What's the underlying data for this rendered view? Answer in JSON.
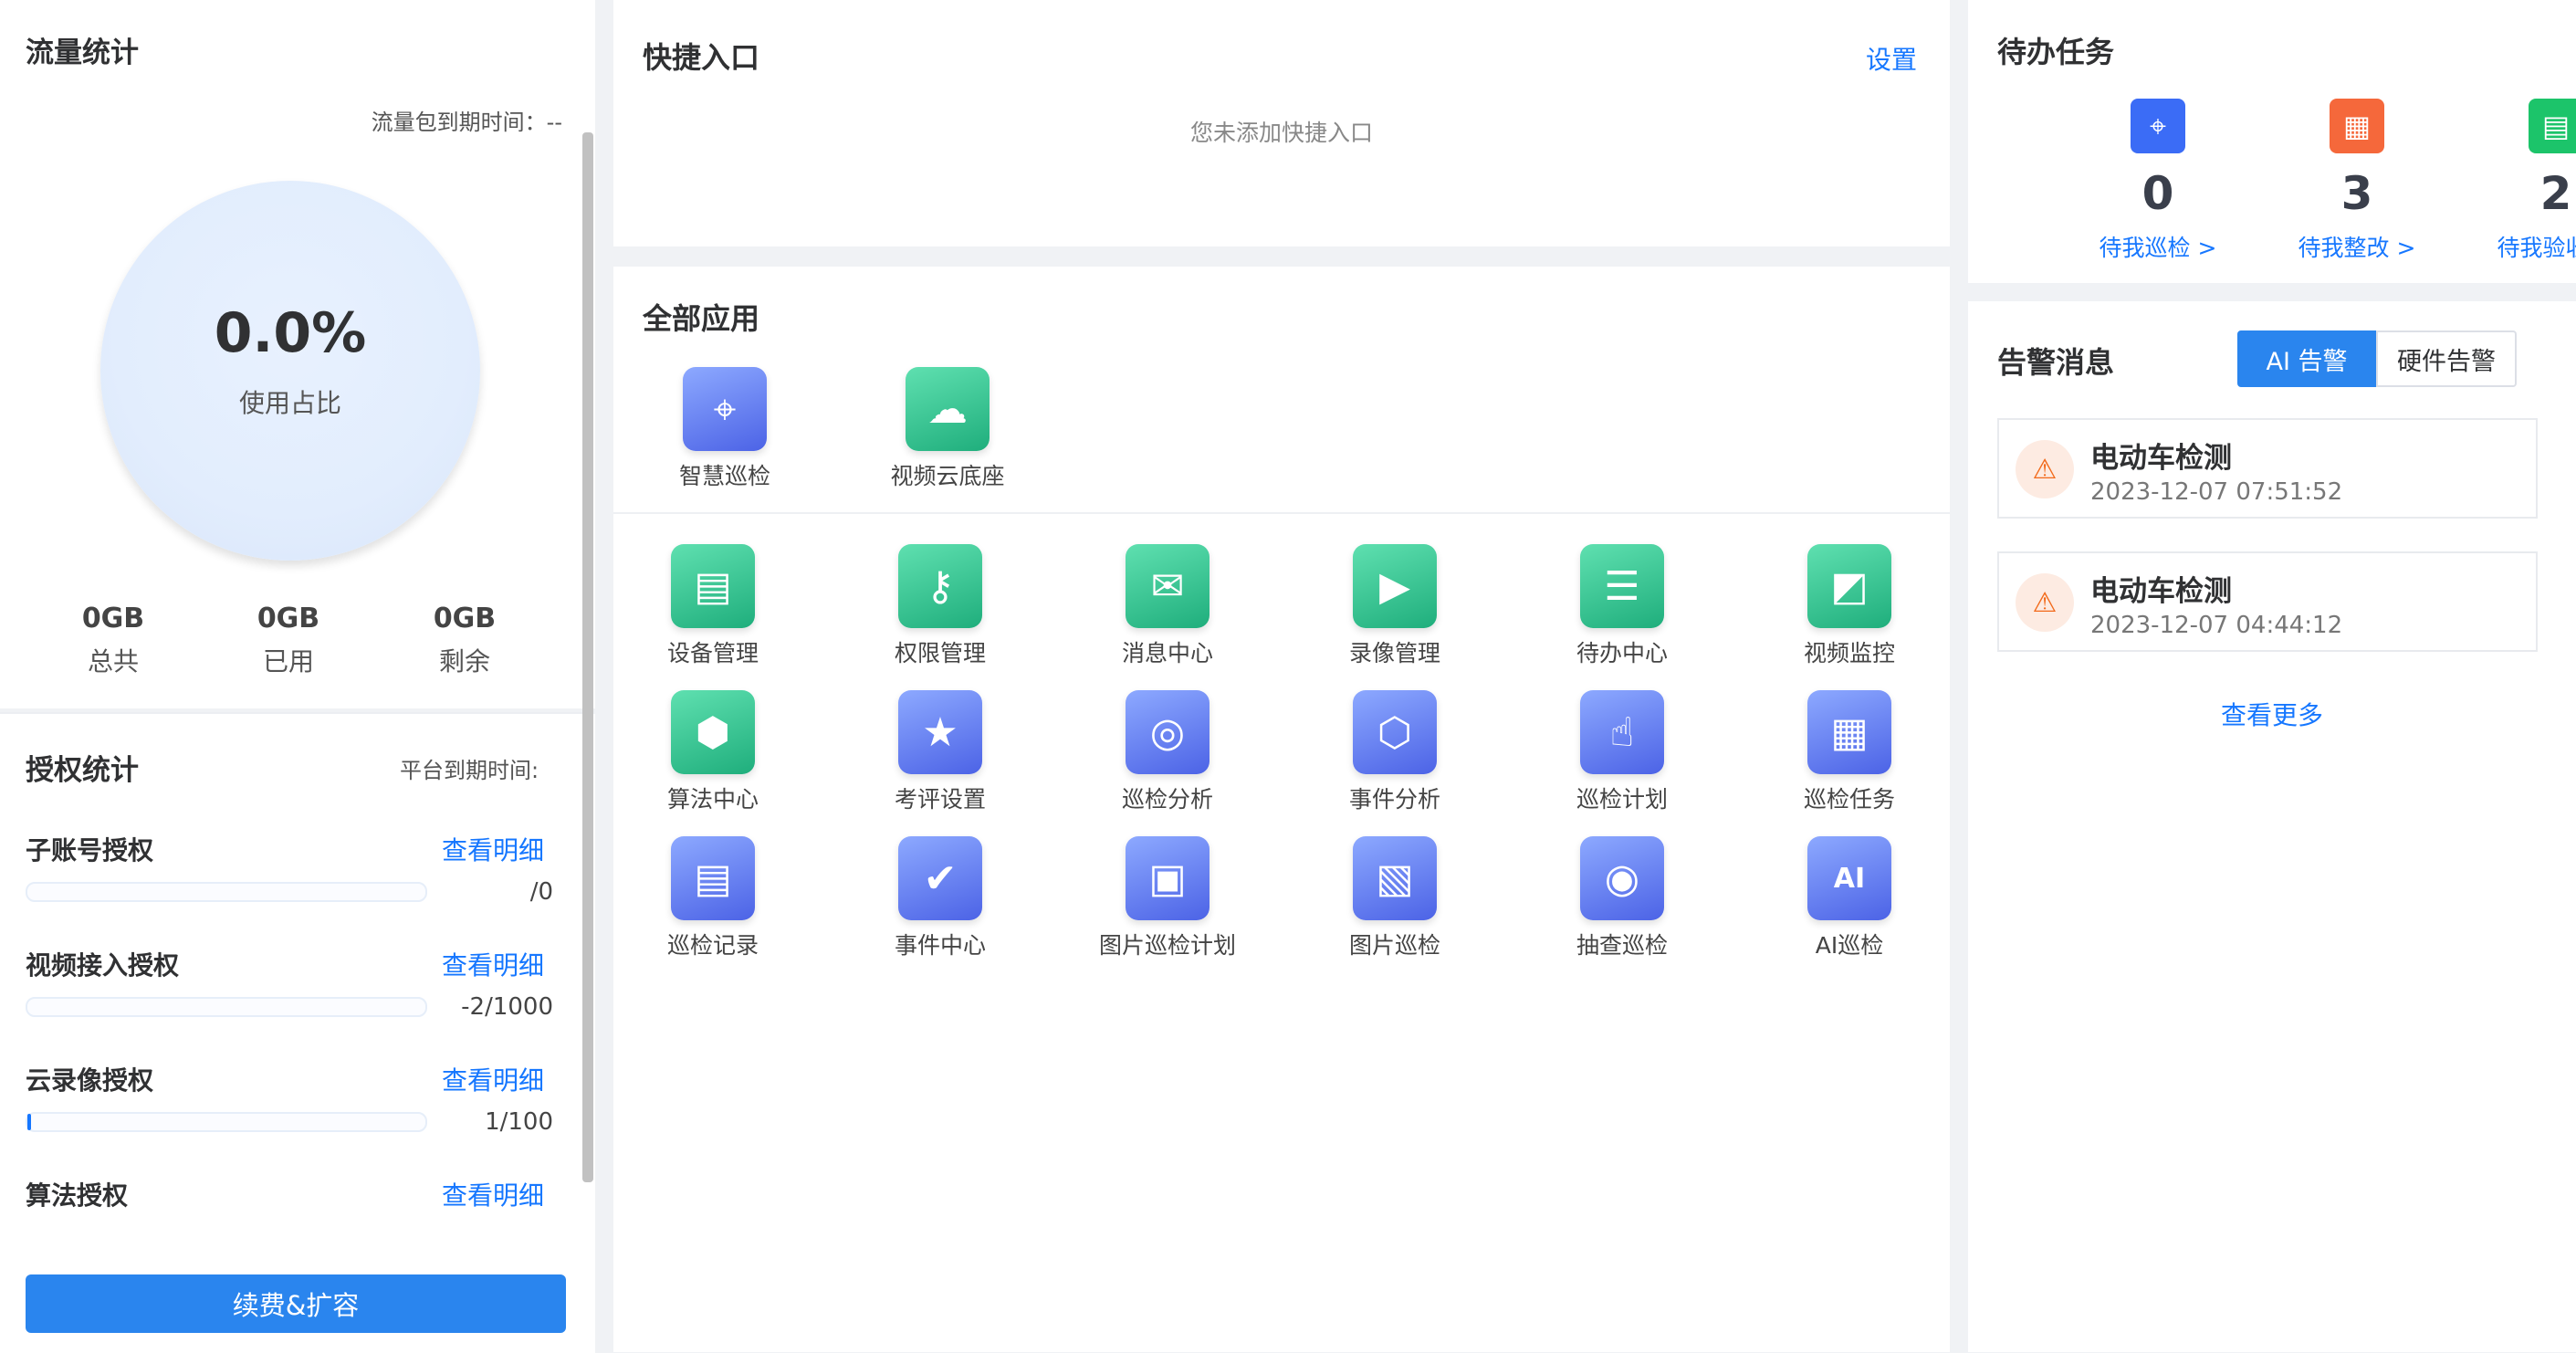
{
  "traffic": {
    "title": "流量统计",
    "expire_label": "流量包到期时间：--",
    "usage_percent": "0.0%",
    "usage_label": "使用占比",
    "stats": [
      {
        "value": "0GB",
        "label": "总共"
      },
      {
        "value": "0GB",
        "label": "已用"
      },
      {
        "value": "0GB",
        "label": "剩余"
      }
    ]
  },
  "license": {
    "title": "授权统计",
    "expire_label": "平台到期时间:",
    "detail_label": "查看明细",
    "items": [
      {
        "name": "子账号授权",
        "value": "/0",
        "progress": 0
      },
      {
        "name": "视频接入授权",
        "value": "-2/1000",
        "progress": 0
      },
      {
        "name": "云录像授权",
        "value": "1/100",
        "progress": 0.01
      },
      {
        "name": "算法授权",
        "value": "",
        "progress": null
      }
    ],
    "renew_button": "续费&扩容"
  },
  "quick": {
    "title": "快捷入口",
    "settings": "设置",
    "empty": "您未添加快捷入口"
  },
  "apps": {
    "title": "全部应用",
    "featured": [
      {
        "label": "智慧巡检",
        "icon": "map-pin-icon",
        "color": "blue"
      },
      {
        "label": "视频云底座",
        "icon": "cloud-play-icon",
        "color": "green"
      }
    ],
    "grid": [
      {
        "label": "设备管理",
        "icon": "server-icon",
        "color": "green"
      },
      {
        "label": "权限管理",
        "icon": "user-key-icon",
        "color": "green"
      },
      {
        "label": "消息中心",
        "icon": "message-icon",
        "color": "green"
      },
      {
        "label": "录像管理",
        "icon": "video-camera-icon",
        "color": "green"
      },
      {
        "label": "待办中心",
        "icon": "todo-list-icon",
        "color": "green"
      },
      {
        "label": "视频监控",
        "icon": "cctv-icon",
        "color": "green"
      },
      {
        "label": "算法中心",
        "icon": "cube-icon",
        "color": "green"
      },
      {
        "label": "考评设置",
        "icon": "clipboard-star-icon",
        "color": "blue"
      },
      {
        "label": "巡检分析",
        "icon": "analysis-icon",
        "color": "blue"
      },
      {
        "label": "事件分析",
        "icon": "bar-chart-icon",
        "color": "blue"
      },
      {
        "label": "巡检计划",
        "icon": "tap-plan-icon",
        "color": "blue"
      },
      {
        "label": "巡检任务",
        "icon": "calendar-pin-icon",
        "color": "blue"
      },
      {
        "label": "巡检记录",
        "icon": "document-icon",
        "color": "blue"
      },
      {
        "label": "事件中心",
        "icon": "shield-check-icon",
        "color": "blue"
      },
      {
        "label": "图片巡检计划",
        "icon": "image-clock-icon",
        "color": "blue"
      },
      {
        "label": "图片巡检",
        "icon": "image-pin-icon",
        "color": "blue"
      },
      {
        "label": "抽查巡检",
        "icon": "webcam-icon",
        "color": "blue"
      },
      {
        "label": "AI巡检",
        "icon": "ai-badge-icon",
        "color": "blue"
      }
    ]
  },
  "todo": {
    "title": "待办任务",
    "items": [
      {
        "count": "0",
        "label": "待我巡检 >",
        "icon": "inspect-pin-icon",
        "color": "#3b6cf6"
      },
      {
        "count": "3",
        "label": "待我整改 >",
        "icon": "rectify-calendar-icon",
        "color": "#f5683b"
      },
      {
        "count": "2",
        "label": "待我验收 >",
        "icon": "accept-document-icon",
        "color": "#1cc46a"
      }
    ]
  },
  "alarm": {
    "title": "告警消息",
    "tab_ai": "AI 告警",
    "tab_hw": "硬件告警",
    "items": [
      {
        "title": "电动车检测",
        "time": "2023-12-07 07:51:52",
        "icon": "siren-icon"
      },
      {
        "title": "电动车检测",
        "time": "2023-12-07 04:44:12",
        "icon": "siren-icon"
      }
    ],
    "more": "查看更多"
  }
}
